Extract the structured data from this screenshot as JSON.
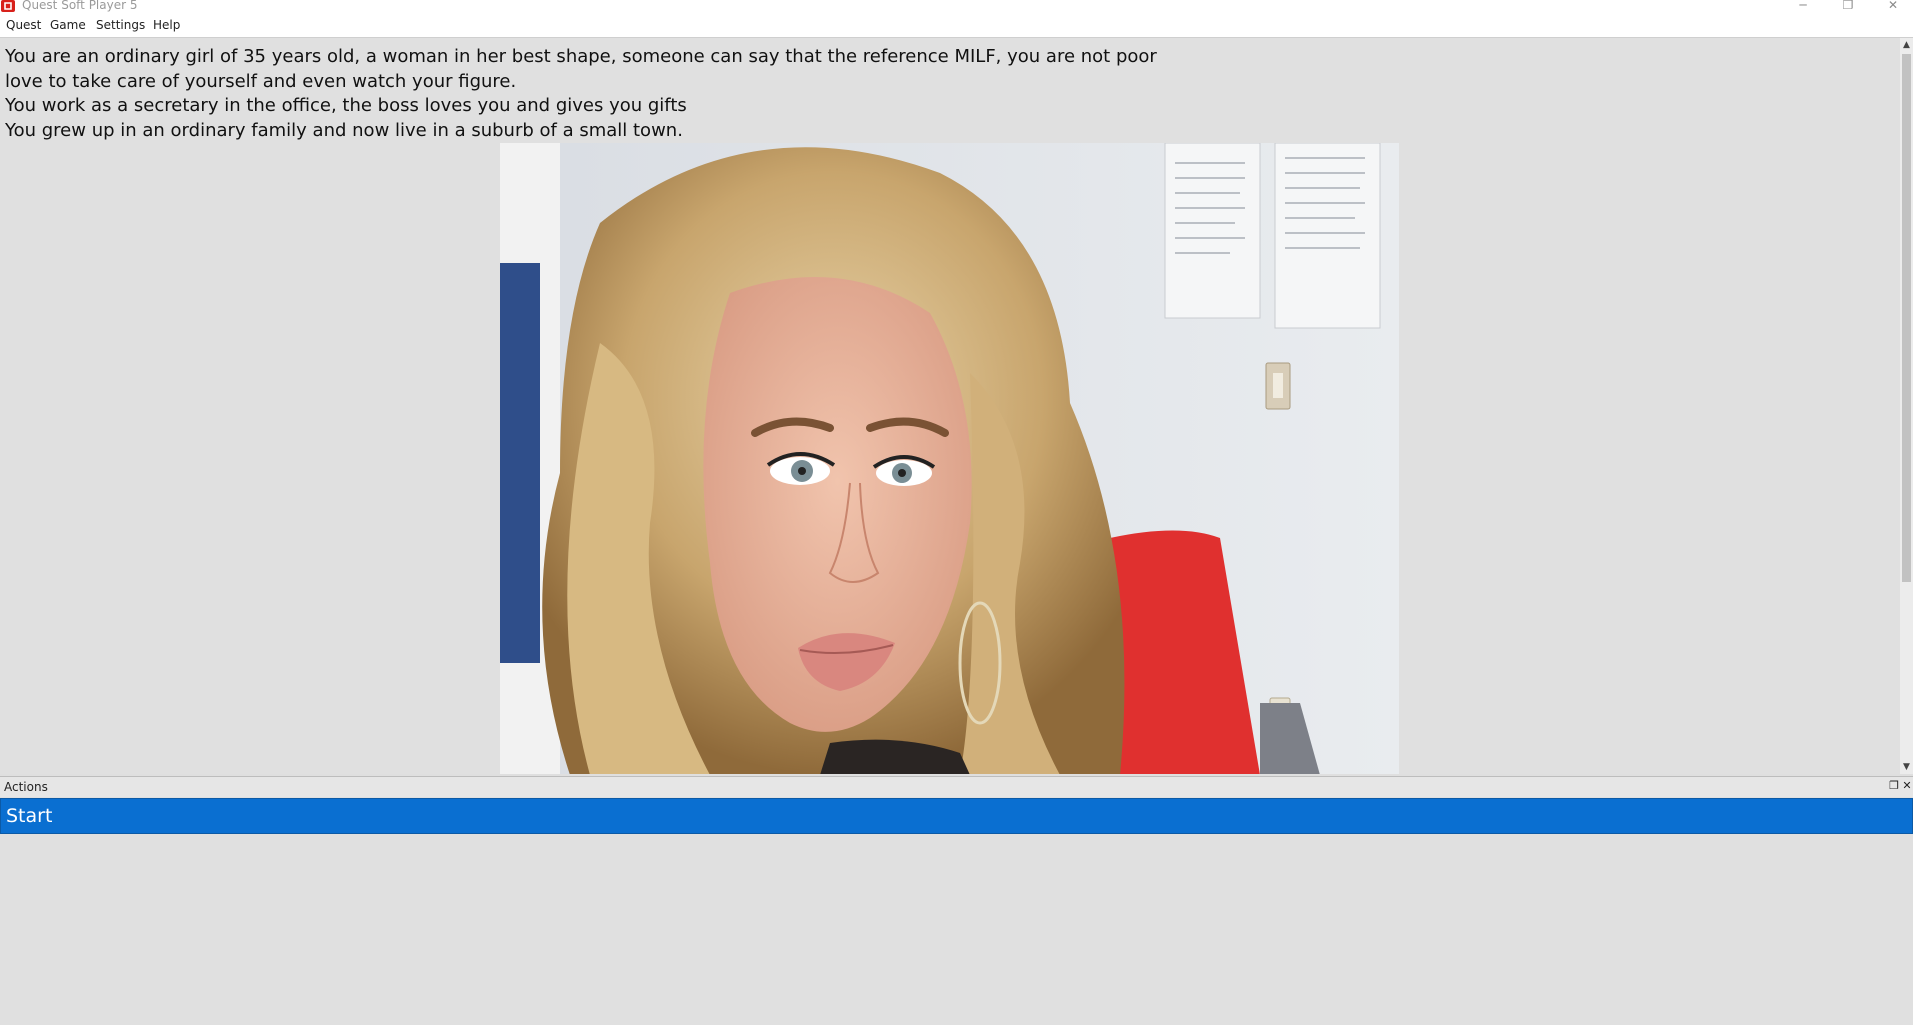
{
  "window": {
    "title": "Quest Soft Player 5",
    "controls": {
      "minimize": "─",
      "maximize": "❐",
      "close": "✕"
    }
  },
  "menu": {
    "items": [
      {
        "label": "Quest"
      },
      {
        "label": "Game"
      },
      {
        "label": "Settings"
      },
      {
        "label": "Help"
      }
    ]
  },
  "story": {
    "lines": [
      " You are an ordinary girl of 35 years old, a woman in her best shape, someone can say that the reference MILF, you are not poor",
      "love to take care of yourself and even watch your figure.",
      "You work as a secretary in the office, the boss loves you and gives you gifts",
      "You grew up in an ordinary family and now live in a suburb of a small town."
    ]
  },
  "scrollbar": {
    "up_arrow": "▲",
    "down_arrow": "▼"
  },
  "actions": {
    "title": "Actions",
    "restore_icon": "❐",
    "close_icon": "✕",
    "items": [
      {
        "label": "Start"
      }
    ]
  },
  "colors": {
    "accent": "#0a6fd1",
    "app_icon": "#d8211b"
  }
}
